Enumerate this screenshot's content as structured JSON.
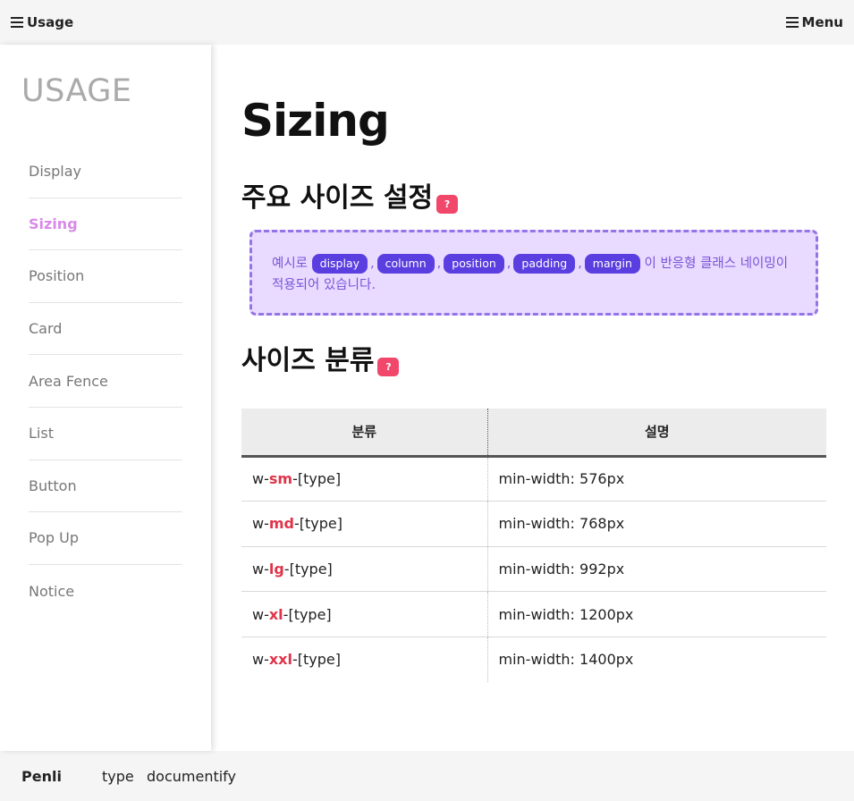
{
  "topbar": {
    "left_label": "Usage",
    "right_label": "Menu"
  },
  "sidebar": {
    "title": "USAGE",
    "items": [
      {
        "label": "Display",
        "active": false
      },
      {
        "label": "Sizing",
        "active": true
      },
      {
        "label": "Position",
        "active": false
      },
      {
        "label": "Card",
        "active": false
      },
      {
        "label": "Area Fence",
        "active": false
      },
      {
        "label": "List",
        "active": false
      },
      {
        "label": "Button",
        "active": false
      },
      {
        "label": "Pop Up",
        "active": false
      },
      {
        "label": "Notice",
        "active": false
      }
    ],
    "active_color": "#d98ae8"
  },
  "main": {
    "title": "Sizing",
    "section1": {
      "heading": "주요 사이즈 설정",
      "help": "?"
    },
    "note": {
      "prefix": "예시로",
      "chips": [
        "display",
        "column",
        "position",
        "padding",
        "margin"
      ],
      "comma": ",",
      "suffix": "이 반응형 클래스 네이밍이 적용되어 있습니다."
    },
    "section2": {
      "heading": "사이즈 분류",
      "help": "?"
    },
    "table": {
      "headers": [
        "분류",
        "설명"
      ],
      "rows": [
        {
          "prefix": "w-",
          "size": "sm",
          "suffix": "-[type]",
          "desc": "min-width: 576px"
        },
        {
          "prefix": "w-",
          "size": "md",
          "suffix": "-[type]",
          "desc": "min-width: 768px"
        },
        {
          "prefix": "w-",
          "size": "lg",
          "suffix": "-[type]",
          "desc": "min-width: 992px"
        },
        {
          "prefix": "w-",
          "size": "xl",
          "suffix": "-[type]",
          "desc": "min-width: 1200px"
        },
        {
          "prefix": "w-",
          "size": "xxl",
          "suffix": "-[type]",
          "desc": "min-width: 1400px"
        }
      ]
    }
  },
  "footer": {
    "brand": "Penli",
    "type_label": "type",
    "type_value": "documentify"
  },
  "colors": {
    "help_badge": "#f0476a",
    "chip": "#5a3ee0",
    "note_bg": "#e9dbff",
    "note_border": "#9574e8",
    "size_highlight": "#e0344a"
  }
}
